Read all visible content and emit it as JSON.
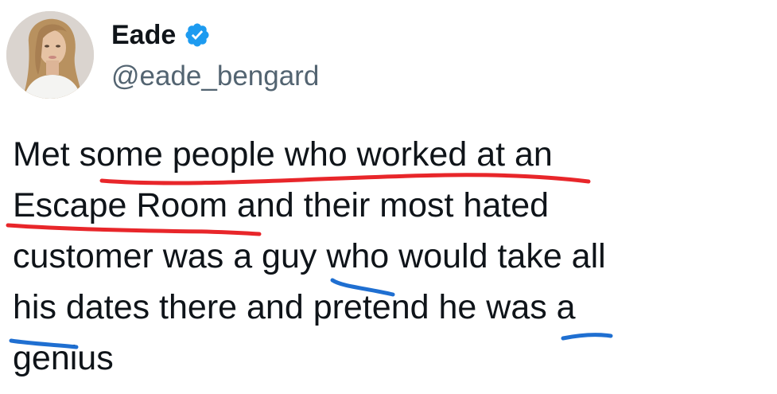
{
  "tweet": {
    "display_name": "Eade",
    "handle": "@eade_bengard",
    "verified_icon": "verified-badge-icon",
    "text": "Met some people who worked at an\nEscape Room and their most hated\ncustomer was a guy who would take all\nhis dates there and pretend he was a\ngenius"
  },
  "colors": {
    "text": "#0f1419",
    "handle": "#536471",
    "verified": "#1d9bf0",
    "red_underline": "#e8262a",
    "blue_underline": "#1f6fd1"
  }
}
